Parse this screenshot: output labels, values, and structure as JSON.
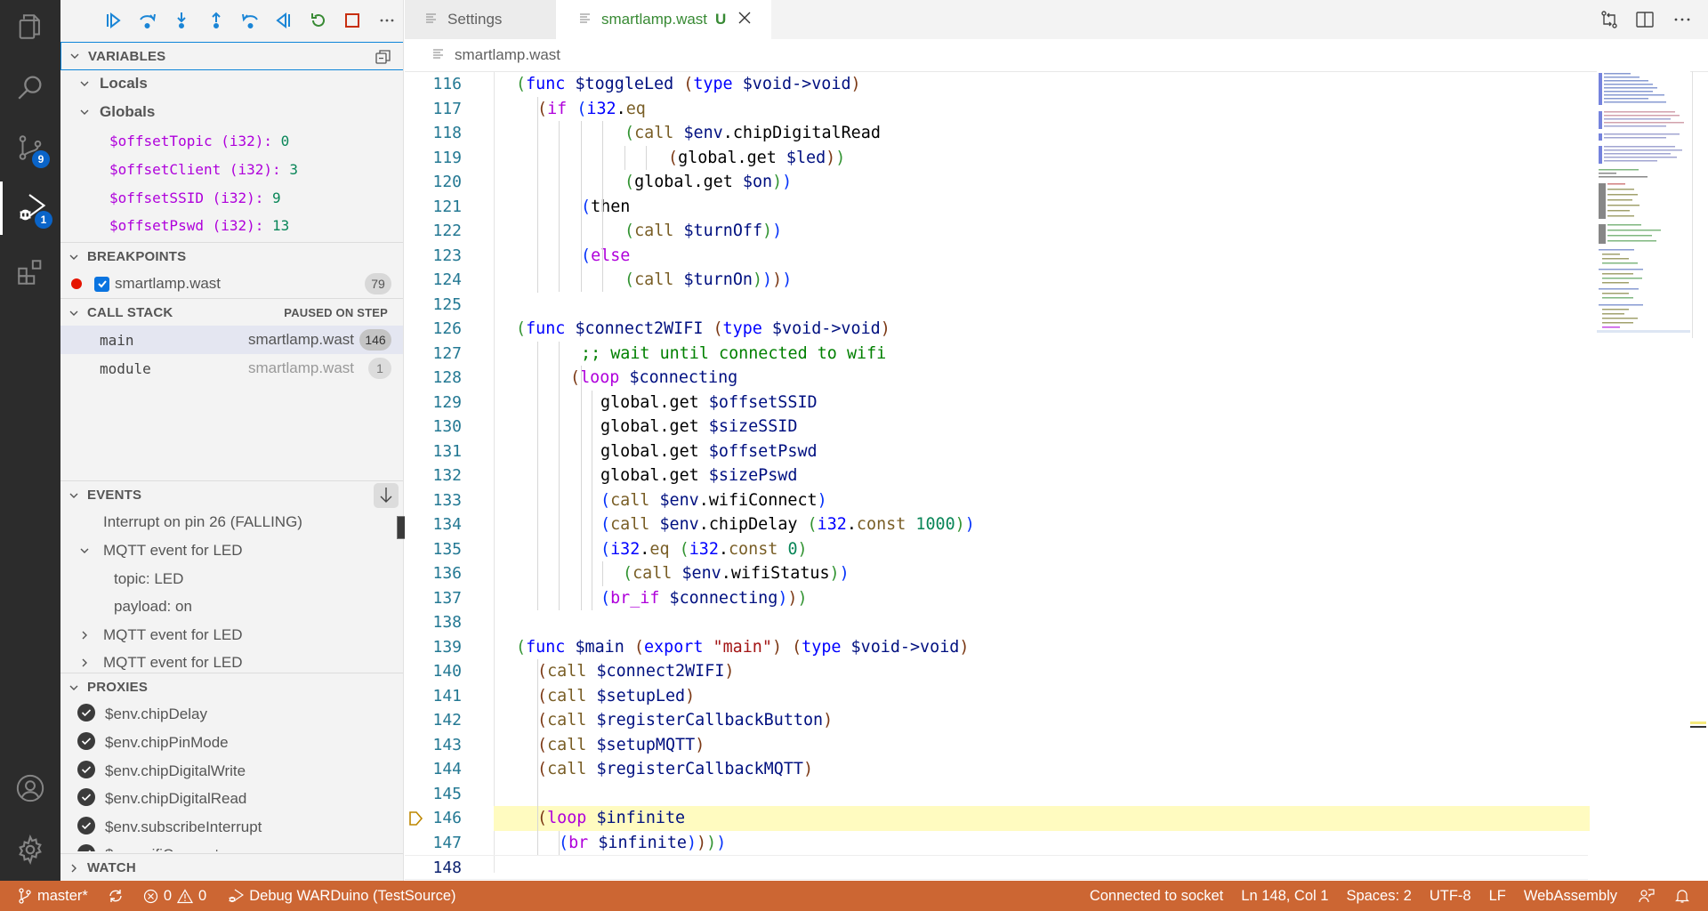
{
  "activity_bar": {
    "items": [
      {
        "name": "explorer",
        "icon": "files-icon"
      },
      {
        "name": "search",
        "icon": "search-icon"
      },
      {
        "name": "source-control",
        "icon": "source-control-icon",
        "badge": "9"
      },
      {
        "name": "run-debug",
        "icon": "debug-icon",
        "badge": "1",
        "active": true
      },
      {
        "name": "extensions",
        "icon": "extensions-icon"
      }
    ],
    "bottom": [
      {
        "name": "accounts",
        "icon": "account-icon"
      },
      {
        "name": "manage",
        "icon": "gear-icon"
      }
    ]
  },
  "debug_toolbar": {
    "buttons": [
      "continue",
      "step-over",
      "step-into",
      "step-out",
      "step-back",
      "reverse-continue",
      "restart",
      "stop",
      "more"
    ]
  },
  "sidebar": {
    "variables": {
      "title": "VARIABLES",
      "locals_label": "Locals",
      "globals_label": "Globals",
      "globals": [
        {
          "name": "$offsetTopic",
          "type": "(i32):",
          "value": "0"
        },
        {
          "name": "$offsetClient",
          "type": "(i32):",
          "value": "3"
        },
        {
          "name": "$offsetSSID",
          "type": "(i32):",
          "value": "9"
        },
        {
          "name": "$offsetPswd",
          "type": "(i32):",
          "value": "13"
        }
      ]
    },
    "breakpoints": {
      "title": "BREAKPOINTS",
      "items": [
        {
          "file": "smartlamp.wast",
          "line": "79",
          "checked": true
        }
      ]
    },
    "call_stack": {
      "title": "CALL STACK",
      "status": "PAUSED ON STEP",
      "frames": [
        {
          "name": "main",
          "file": "smartlamp.wast",
          "line": "146"
        },
        {
          "name": "module",
          "file": "smartlamp.wast",
          "line": "1"
        }
      ]
    },
    "events": {
      "title": "EVENTS",
      "action_tooltip": "Pop event",
      "items": [
        {
          "label": "Interrupt on pin 26 (FALLING)"
        },
        {
          "label": "MQTT event for LED",
          "expanded": true,
          "children": [
            "topic: LED",
            "payload: on"
          ]
        },
        {
          "label": "MQTT event for LED",
          "expanded": false
        },
        {
          "label": "MQTT event for LED",
          "expanded": false
        }
      ]
    },
    "proxies": {
      "title": "PROXIES",
      "items": [
        "$env.chipDelay",
        "$env.chipPinMode",
        "$env.chipDigitalWrite",
        "$env.chipDigitalRead",
        "$env.subscribeInterrupt",
        "$env.wifiConnect"
      ]
    },
    "watch": {
      "title": "WATCH"
    }
  },
  "tabs": [
    {
      "label": "Settings",
      "active": false
    },
    {
      "label": "smartlamp.wast",
      "status": "U",
      "active": true
    }
  ],
  "breadcrumb": "smartlamp.wast",
  "editor": {
    "current_line": 146,
    "lines": [
      116,
      117,
      118,
      119,
      120,
      121,
      122,
      123,
      124,
      125,
      126,
      127,
      128,
      129,
      130,
      131,
      132,
      133,
      134,
      135,
      136,
      137,
      138,
      139,
      140,
      141,
      142,
      143,
      144,
      145,
      146,
      147,
      148
    ]
  },
  "statusbar": {
    "branch": "master*",
    "errors": "0",
    "warnings": "0",
    "debug_config": "Debug WARDuino (TestSource)",
    "connection": "Connected to socket",
    "cursor": "Ln 148, Col 1",
    "indent": "Spaces: 2",
    "encoding": "UTF-8",
    "eol": "LF",
    "language": "WebAssembly"
  },
  "colors": {
    "statusbar": "#cc6633",
    "activity_bar": "#2c2c2c",
    "badge": "#0a64c8",
    "current_line_highlight": "#fffbc0",
    "breakpoint": "#e51400"
  }
}
